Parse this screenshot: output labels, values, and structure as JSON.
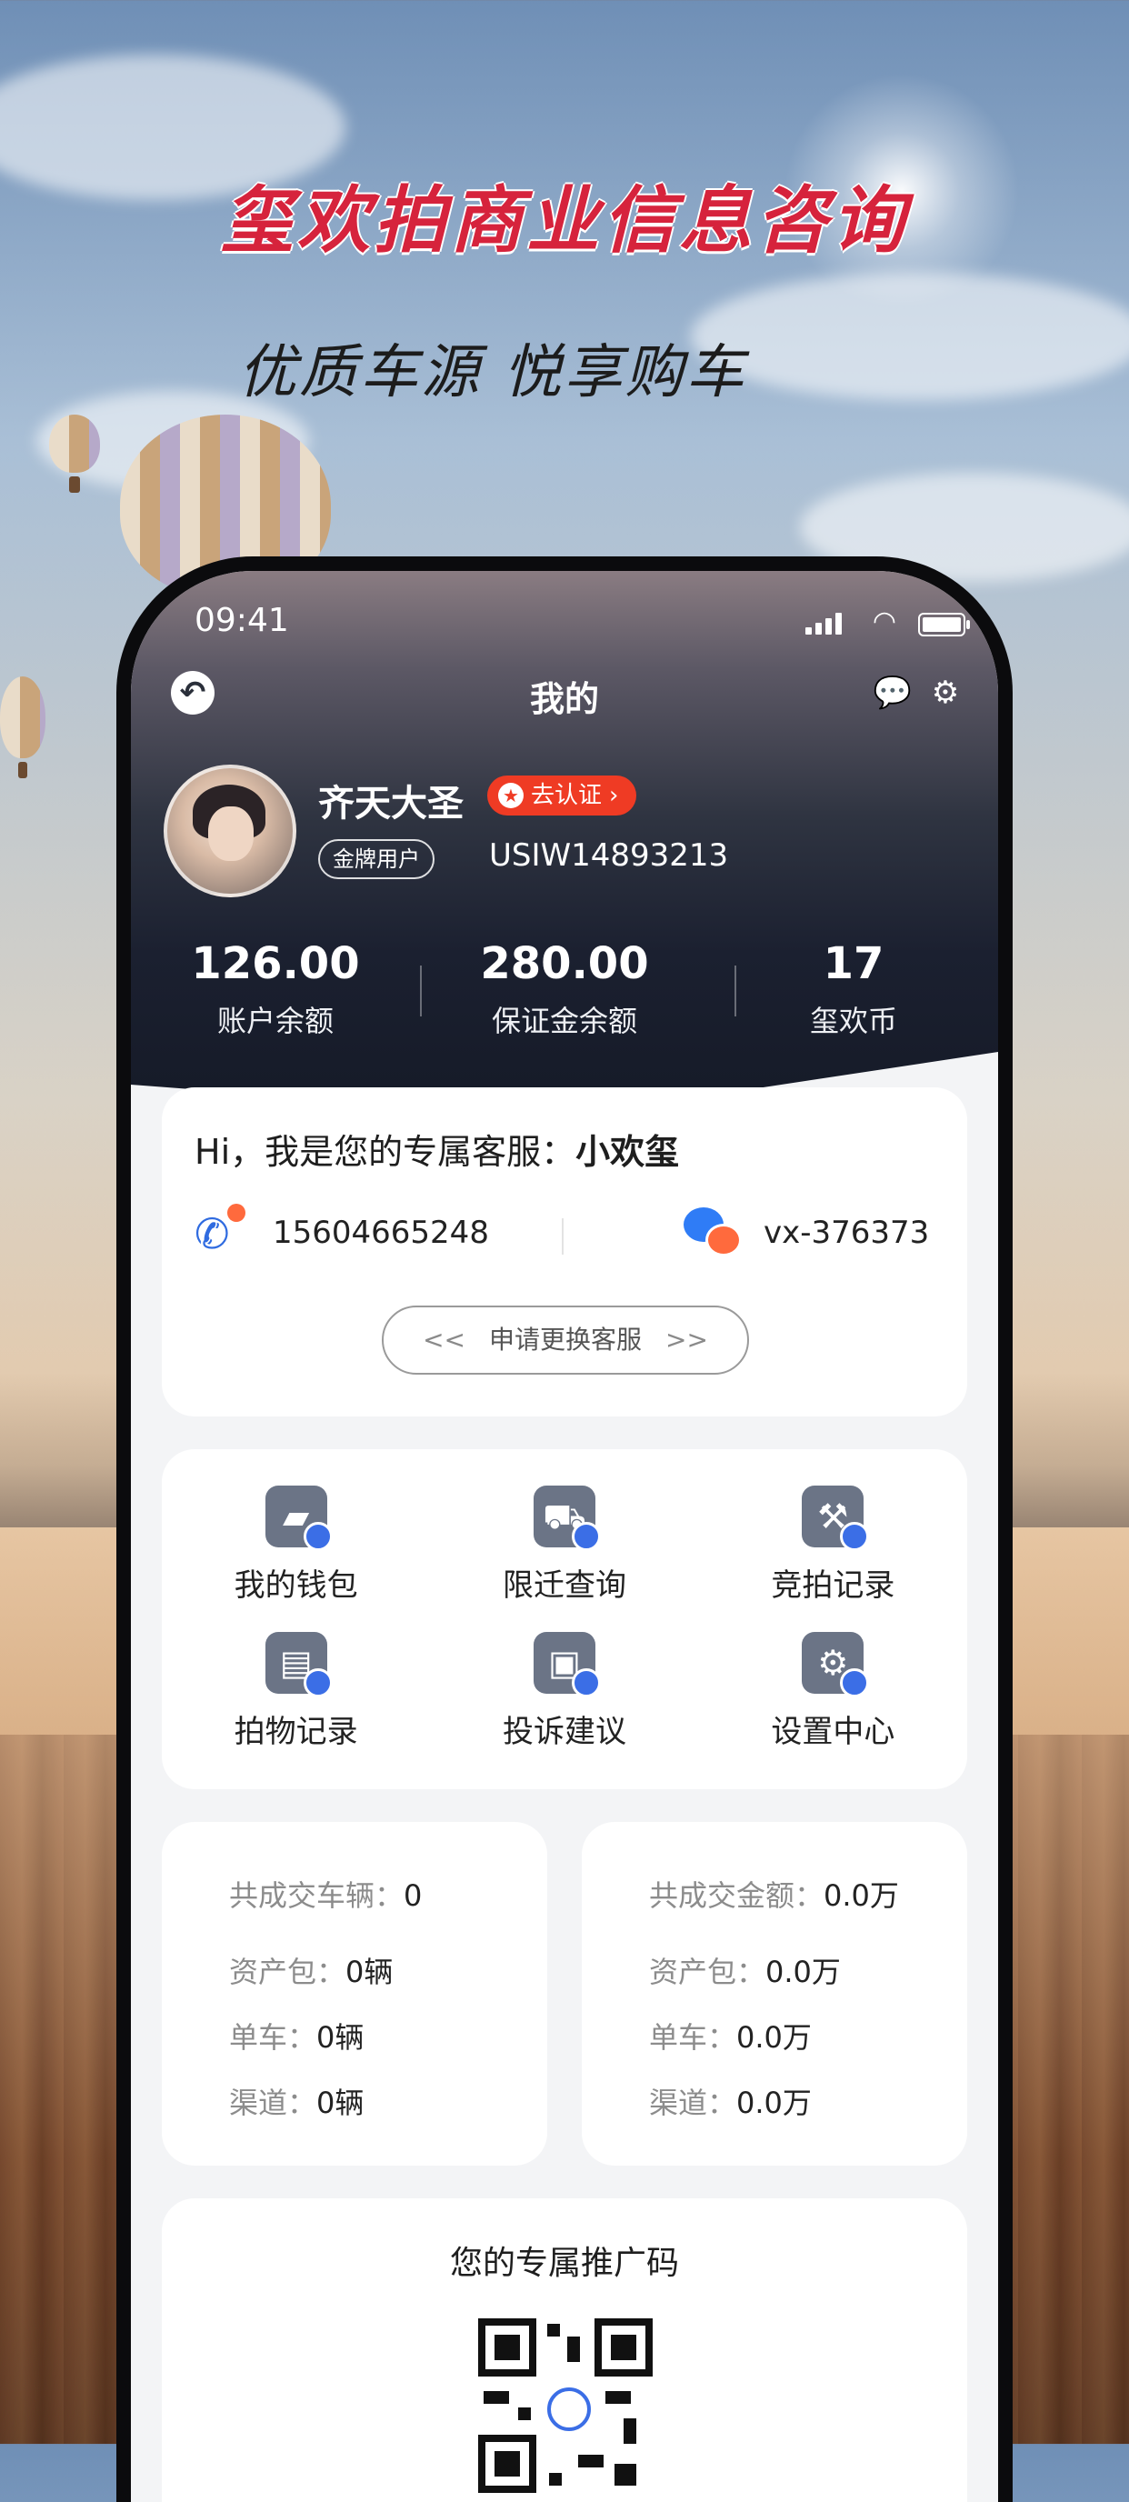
{
  "headline": "玺欢拍商业信息咨询",
  "subhead": "优质车源 悦享购车",
  "status_bar": {
    "time": "09:41"
  },
  "nav": {
    "title": "我的"
  },
  "profile": {
    "name": "齐天大圣",
    "verify_label": "去认证",
    "verify_chevron": "›",
    "member_tag": "金牌用户",
    "user_id": "USIW14893213"
  },
  "stats": [
    {
      "value": "126.00",
      "label": "账户余额"
    },
    {
      "value": "280.00",
      "label": "保证金余额"
    },
    {
      "value": "17",
      "label": "玺欢币"
    }
  ],
  "service": {
    "greeting_prefix": "Hi，我是您的专属客服：",
    "agent_name": "小欢玺",
    "phone": "15604665248",
    "wechat": "vx-376373",
    "change_button": "申请更换客服",
    "chevron_left": "<<",
    "chevron_right": ">>"
  },
  "menu": [
    {
      "label": "我的钱包",
      "icon": "wallet-icon",
      "glyph": "▰"
    },
    {
      "label": "限迁查询",
      "icon": "car-search-icon",
      "glyph": "🚗"
    },
    {
      "label": "竞拍记录",
      "icon": "gavel-icon",
      "glyph": "⚒"
    },
    {
      "label": "拍物记录",
      "icon": "document-search-icon",
      "glyph": "▤"
    },
    {
      "label": "投诉建议",
      "icon": "box-pen-icon",
      "glyph": "▣"
    },
    {
      "label": "设置中心",
      "icon": "gear-icon",
      "glyph": "⚙"
    }
  ],
  "left_stats": {
    "total": {
      "label": "共成交车辆：",
      "value": "0"
    },
    "package": {
      "label": "资产包：",
      "value": "0辆"
    },
    "single": {
      "label": "单车：",
      "value": "0辆"
    },
    "channel": {
      "label": "渠道：",
      "value": "0辆"
    }
  },
  "right_stats": {
    "total": {
      "label": "共成交金额：",
      "value": "0.0万"
    },
    "package": {
      "label": "资产包：",
      "value": "0.0万"
    },
    "single": {
      "label": "单车：",
      "value": "0.0万"
    },
    "channel": {
      "label": "渠道：",
      "value": "0.0万"
    }
  },
  "promo": {
    "title": "您的专属推广码"
  },
  "colors": {
    "headline_red": "#d6233c",
    "badge_red": "#ef3b24",
    "accent_blue": "#2f6be0",
    "icon_gray": "#6b7486"
  }
}
